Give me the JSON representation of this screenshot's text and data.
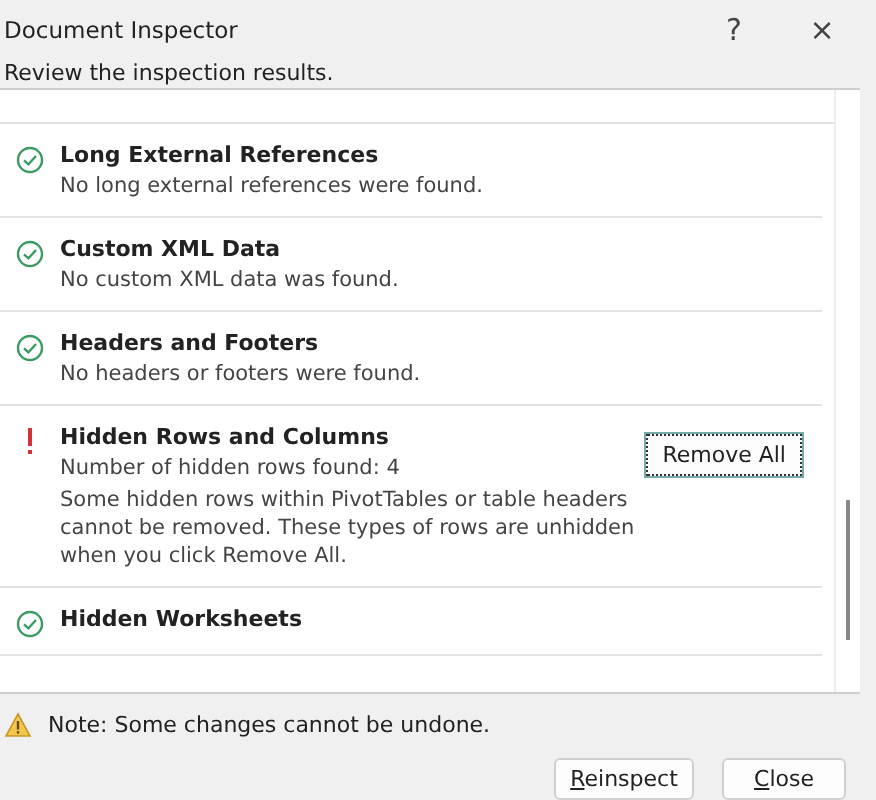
{
  "window": {
    "title": "Document Inspector",
    "help": "?",
    "close": "×"
  },
  "instruction": "Review the inspection results.",
  "results": [
    {
      "kind": "ok",
      "title": "Long External References",
      "lines": [
        "No long external references were found."
      ]
    },
    {
      "kind": "ok",
      "title": "Custom XML Data",
      "lines": [
        "No custom XML data was found."
      ]
    },
    {
      "kind": "ok",
      "title": "Headers and Footers",
      "lines": [
        "No headers or footers were found."
      ]
    },
    {
      "kind": "issue",
      "title": "Hidden Rows and Columns",
      "lines": [
        "Number of hidden rows found: 4",
        "Some hidden rows within PivotTables or table headers cannot be removed. These types of rows are unhidden when you click Remove All."
      ],
      "action": "Remove All"
    },
    {
      "kind": "ok",
      "title": "Hidden Worksheets"
    }
  ],
  "note": "Note: Some changes cannot be undone.",
  "buttons": [
    {
      "label": "Reinspect"
    },
    {
      "label": "Close"
    }
  ]
}
